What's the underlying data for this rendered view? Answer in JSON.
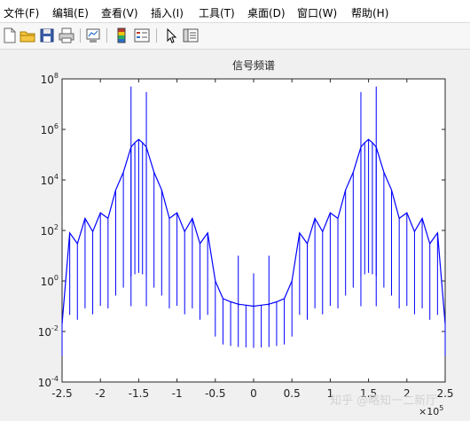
{
  "menubar": {
    "items": [
      {
        "label": "文件(F)"
      },
      {
        "label": "编辑(E)"
      },
      {
        "label": "查看(V)"
      },
      {
        "label": "插入(I)"
      },
      {
        "label": "工具(T)"
      },
      {
        "label": "桌面(D)"
      },
      {
        "label": "窗口(W)"
      },
      {
        "label": "帮助(H)"
      }
    ]
  },
  "toolbar": {
    "buttons": [
      {
        "icon": "new-figure-icon"
      },
      {
        "icon": "open-folder-icon"
      },
      {
        "icon": "save-icon"
      },
      {
        "icon": "print-icon"
      },
      {
        "icon": "link-plot-icon"
      },
      {
        "icon": "colorbar-icon"
      },
      {
        "icon": "legend-icon"
      },
      {
        "icon": "pointer-icon"
      },
      {
        "icon": "property-editor-icon"
      }
    ]
  },
  "watermark": "知乎 @略知一二新厅",
  "chart_data": {
    "type": "line",
    "title": "信号频谱",
    "xlabel": "",
    "ylabel": "",
    "xlim": [
      -250000,
      250000
    ],
    "ylim": [
      0.0001,
      100000000
    ],
    "yscale": "log",
    "line_color": "#0000ff",
    "xticks": [
      -2.5,
      -2,
      -1.5,
      -1,
      -0.5,
      0,
      0.5,
      1,
      1.5,
      2,
      2.5
    ],
    "xtick_labels": [
      "-2.5",
      "-2",
      "-1.5",
      "-1",
      "-0.5",
      "0",
      "0.5",
      "1",
      "1.5",
      "2",
      "2.5"
    ],
    "x_multiplier_base": "×10",
    "x_multiplier_exp": "5",
    "yticks": [
      {
        "base": "10",
        "exp": "8"
      },
      {
        "base": "10",
        "exp": "6"
      },
      {
        "base": "10",
        "exp": "4"
      },
      {
        "base": "10",
        "exp": "2"
      },
      {
        "base": "10",
        "exp": "0"
      },
      {
        "base": "10",
        "exp": "-2"
      },
      {
        "base": "10",
        "exp": "-4"
      }
    ],
    "series": [
      {
        "x": [
          -250000,
          -240000,
          -230000,
          -220000,
          -210000,
          -200000,
          -190000,
          -180000,
          -170000,
          -160000,
          -155000,
          -150000,
          -145000,
          -140000,
          -130000,
          -120000,
          -110000,
          -100000,
          -90000,
          -80000,
          -70000,
          -60000,
          -50000,
          -40000,
          -30000,
          -20000,
          -10000,
          0,
          10000,
          20000,
          30000,
          40000,
          50000,
          60000,
          70000,
          80000,
          90000,
          100000,
          110000,
          120000,
          130000,
          140000,
          145000,
          150000,
          155000,
          160000,
          170000,
          180000,
          190000,
          200000,
          210000,
          220000,
          230000,
          240000,
          250000
        ],
        "y": [
          0.02,
          80,
          30,
          300,
          90,
          500,
          300,
          4000,
          20000,
          200000,
          300000,
          400000,
          300000,
          200000,
          20000,
          4000,
          300,
          500,
          90,
          300,
          30,
          80,
          1,
          0.2,
          0.15,
          0.12,
          0.11,
          0.1,
          0.11,
          0.12,
          0.15,
          0.2,
          1,
          80,
          30,
          300,
          90,
          500,
          300,
          4000,
          20000,
          200000,
          300000,
          400000,
          300000,
          200000,
          20000,
          4000,
          300,
          500,
          90,
          300,
          30,
          80,
          0.02
        ]
      }
    ],
    "spikes": [
      {
        "x": -160000,
        "y": 50000000
      },
      {
        "x": -140000,
        "y": 30000000
      },
      {
        "x": -20000,
        "y": 10
      },
      {
        "x": 0,
        "y": 2
      },
      {
        "x": 20000,
        "y": 10
      },
      {
        "x": 140000,
        "y": 30000000
      },
      {
        "x": 160000,
        "y": 50000000
      }
    ]
  }
}
